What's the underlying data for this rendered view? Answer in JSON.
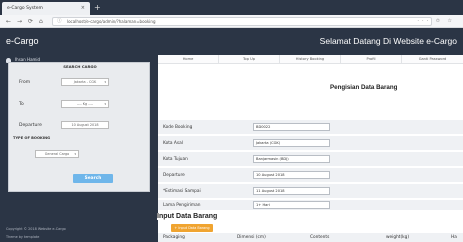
{
  "browser": {
    "tab_title": "e-Cargo System",
    "tab_close": "×",
    "new_tab": "+",
    "back": "←",
    "forward": "→",
    "reload": "⟳",
    "home": "⌂",
    "url": "localhost/e-cargo/admin/?halaman=booking",
    "toolbar_icons": "··· ✩ ☆"
  },
  "header": {
    "logo": "e-Cargo",
    "welcome": "Selamat Datang Di Website e-Cargo"
  },
  "sidebar": {
    "user": "Ihsan Hamid",
    "search_title": "SEARCH CARGO",
    "from_label": "From",
    "from_value": "Jakarta - CGK",
    "to_label": "To",
    "to_value": "---- Kg ----",
    "departure_label": "Departure",
    "departure_value": "10 August 2018",
    "booking_type_title": "TYPE OF BOOKING",
    "booking_type_value": "General Cargo",
    "search_button": "Search",
    "footer_1": "Copyright © 2018 Website e-Cargo",
    "footer_2": "Theme by template"
  },
  "nav": {
    "items": [
      "Home",
      "Top Up",
      "History Booking",
      "Profil",
      "Ganti Password"
    ]
  },
  "form": {
    "title": "Pengisian Data Barang",
    "rows": [
      {
        "label": "Kode Booking",
        "value": "BD0022"
      },
      {
        "label": "Kota Asal",
        "value": "Jakarta (CGK)"
      },
      {
        "label": "Kota Tujuan",
        "value": "Banjarmasin (BDJ)"
      },
      {
        "label": "Departure",
        "value": "10 August 2018"
      },
      {
        "label": "*Estimasi Sampai",
        "value": "11 August 2018"
      },
      {
        "label": "Lama Pengiriman",
        "value": "1+ Hari"
      }
    ]
  },
  "input_section": {
    "title": "Input Data Barang",
    "add_button": "+ Input Data Barang",
    "columns": [
      "Packaging",
      "Dimensi (cm)",
      "Contents",
      "weight(kg)",
      "Ha"
    ]
  }
}
